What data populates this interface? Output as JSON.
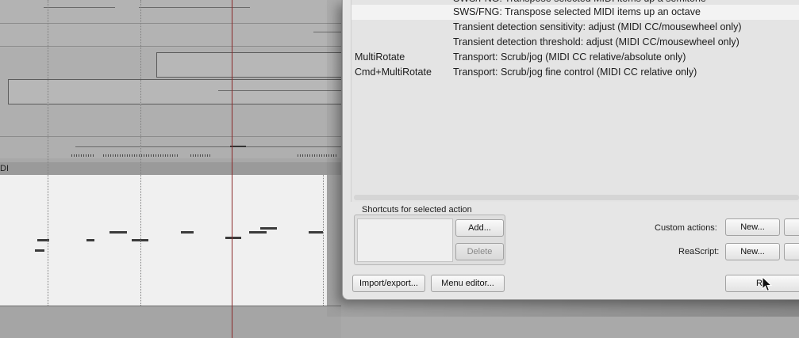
{
  "arrange": {
    "midi_track_label": "DI"
  },
  "actions_list": {
    "rows": [
      {
        "shortcut": "",
        "description": "SWS/FNG: Transpose selected MIDI items up a semitone",
        "partial": true
      },
      {
        "shortcut": "",
        "description": "SWS/FNG: Transpose selected MIDI items up an octave",
        "selected": true
      },
      {
        "shortcut": "",
        "description": "Transient detection sensitivity: adjust (MIDI CC/mousewheel only)"
      },
      {
        "shortcut": "",
        "description": "Transient detection threshold: adjust (MIDI CC/mousewheel only)"
      },
      {
        "shortcut": "MultiRotate",
        "description": "Transport: Scrub/jog (MIDI CC relative/absolute only)"
      },
      {
        "shortcut": "Cmd+MultiRotate",
        "description": "Transport: Scrub/jog fine control (MIDI CC relative only)"
      }
    ]
  },
  "shortcuts_panel": {
    "title": "Shortcuts for selected action",
    "add_label": "Add...",
    "delete_label": "Delete"
  },
  "custom_actions": {
    "label": "Custom actions:",
    "new_label": "New..."
  },
  "reascript": {
    "label": "ReaScript:",
    "new_label": "New..."
  },
  "footer": {
    "import_export_label": "Import/export...",
    "menu_editor_label": "Menu editor...",
    "run_label": "R"
  }
}
